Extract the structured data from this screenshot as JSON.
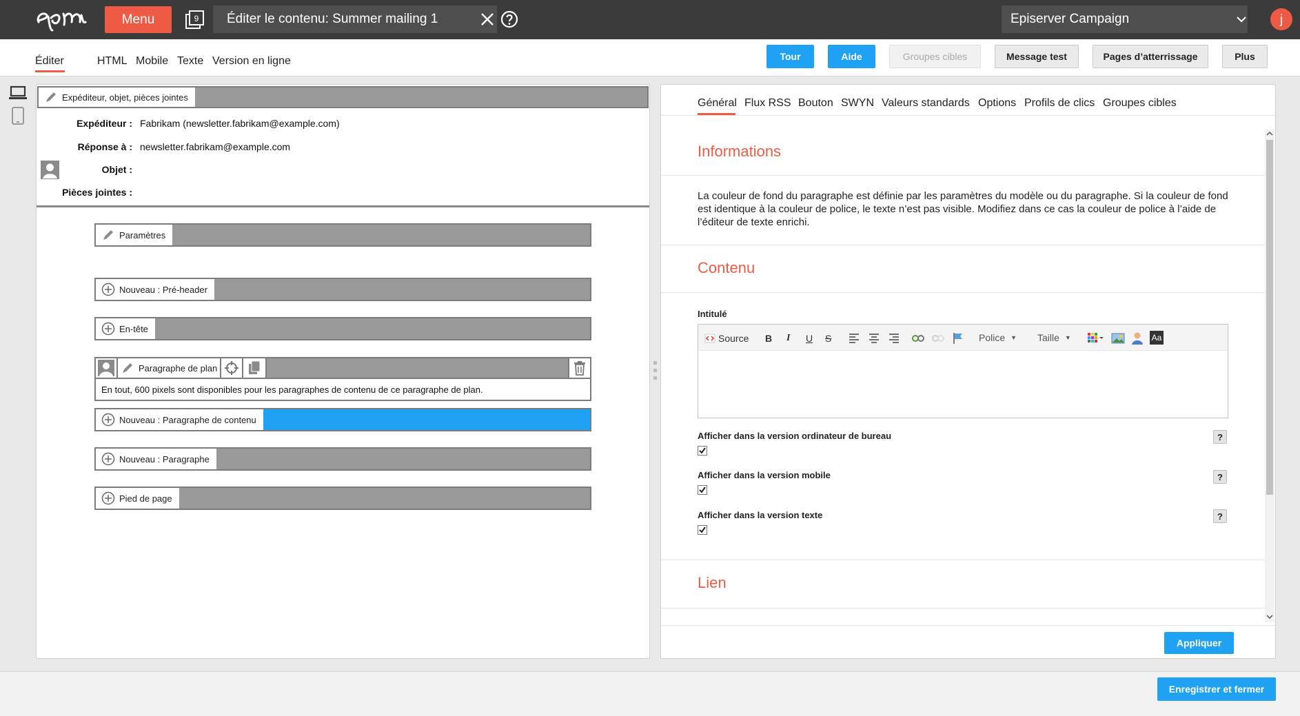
{
  "topbar": {
    "menu_label": "Menu",
    "tasks_count": "9",
    "page_title": "Éditer le contenu: Summer mailing 1",
    "account": "Episerver Campaign",
    "user_initial": "j"
  },
  "modes": {
    "tabs": [
      "Éditer",
      "HTML",
      "Mobile",
      "Texte",
      "Version en ligne"
    ],
    "active": "Éditer"
  },
  "toolbar": {
    "tour": "Tour",
    "aide": "Aide",
    "groupes_cibles": "Groupes cibles",
    "message_test": "Message test",
    "pages_atterrissage": "Pages d’atterrissage",
    "plus": "Plus"
  },
  "header_block": {
    "title": "Expéditeur, objet, pièces jointes",
    "fields": [
      {
        "label": "Expéditeur :",
        "value": "Fabrikam (newsletter.fabrikam@example.com)"
      },
      {
        "label": "Réponse à :",
        "value": "newsletter.fabrikam@example.com"
      },
      {
        "label": "Objet :",
        "value": ""
      },
      {
        "label": "Pièces jointes :",
        "value": ""
      }
    ]
  },
  "template_blocks": {
    "parametres": "Paramètres",
    "preheader": "Nouveau : Pré-header",
    "entete": "En-tête",
    "plan": "Paragraphe de plan",
    "plan_info": "En tout, 600 pixels sont disponibles pour les paragraphes de contenu de ce paragraphe de plan.",
    "contenu": "Nouveau : Paragraphe de contenu",
    "paragraphe": "Nouveau : Paragraphe",
    "pied": "Pied de page"
  },
  "properties": {
    "tabs": [
      "Général",
      "Flux RSS",
      "Bouton",
      "SWYN",
      "Valeurs standards",
      "Options",
      "Profils de clics",
      "Groupes cibles"
    ],
    "active_tab": "Général",
    "sections": {
      "informations": "Informations",
      "info_text": "La couleur de fond du paragraphe est définie par les paramètres du modèle ou du paragraphe. Si la couleur de fond est identique à la couleur de police, le texte n’est pas visible. Modifiez dans ce cas la couleur de police à l’aide de l’éditeur de texte enrichi.",
      "contenu": "Contenu",
      "lien": "Lien"
    },
    "intitule_label": "Intitulé",
    "rte": {
      "source": "Source",
      "police": "Police",
      "taille": "Taille",
      "bold": "B",
      "italic": "I",
      "underline": "U",
      "strike": "S",
      "aa": "Aa"
    },
    "checkboxes": [
      {
        "label": "Afficher dans la version ordinateur de bureau",
        "checked": true
      },
      {
        "label": "Afficher dans la version mobile",
        "checked": true
      },
      {
        "label": "Afficher dans la version texte",
        "checked": true
      }
    ],
    "help": "?",
    "apply": "Appliquer"
  },
  "footer": {
    "save_close": "Enregistrer et fermer"
  },
  "colors": {
    "accent": "#ed5b45",
    "primary": "#1fa1f4",
    "topbar": "#3b3b3b"
  }
}
